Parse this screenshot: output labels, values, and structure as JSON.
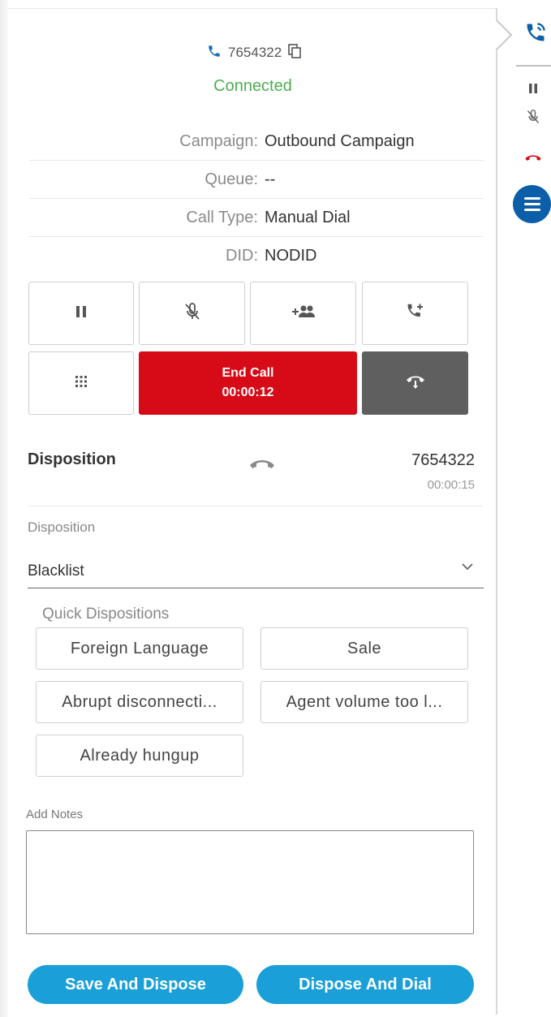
{
  "header": {
    "phone_number": "7654322",
    "status": "Connected"
  },
  "call_info": [
    {
      "label": "Campaign:",
      "value": "Outbound Campaign"
    },
    {
      "label": "Queue:",
      "value": "--"
    },
    {
      "label": "Call Type:",
      "value": "Manual Dial"
    },
    {
      "label": "DID:",
      "value": "NODID"
    }
  ],
  "controls": {
    "end_call_label": "End Call",
    "end_call_timer": "00:00:12"
  },
  "disposition_summary": {
    "title": "Disposition",
    "number": "7654322",
    "duration": "00:00:15"
  },
  "disposition_field": {
    "label": "Disposition",
    "selected": "Blacklist"
  },
  "quick_dispositions": {
    "label": "Quick Dispositions",
    "items": [
      "Foreign Language",
      "Sale",
      "Abrupt disconnecti...",
      "Agent volume too l...",
      "Already hungup"
    ]
  },
  "notes": {
    "label": "Add Notes",
    "value": ""
  },
  "actions": {
    "save_and_dispose": "Save And Dispose",
    "dispose_and_dial": "Dispose And Dial"
  },
  "colors": {
    "connected": "#4caf50",
    "end_call": "#d60b17",
    "hold_button": "#5f5f5f",
    "primary_action": "#1a9fd8",
    "menu_circle": "#0b5ea8",
    "rail_hangup": "#d60b17"
  },
  "icons": {
    "header": "phone-icon",
    "copy": "copy-icon",
    "controls": [
      "pause-icon",
      "mute-icon",
      "add-participant-icon",
      "transfer-icon",
      "dialpad-icon",
      "hold-icon"
    ],
    "disposition_summary": "hangup-icon",
    "rail": [
      "active-call-icon",
      "pause-icon",
      "mute-icon",
      "hangup-icon",
      "menu-icon"
    ]
  }
}
